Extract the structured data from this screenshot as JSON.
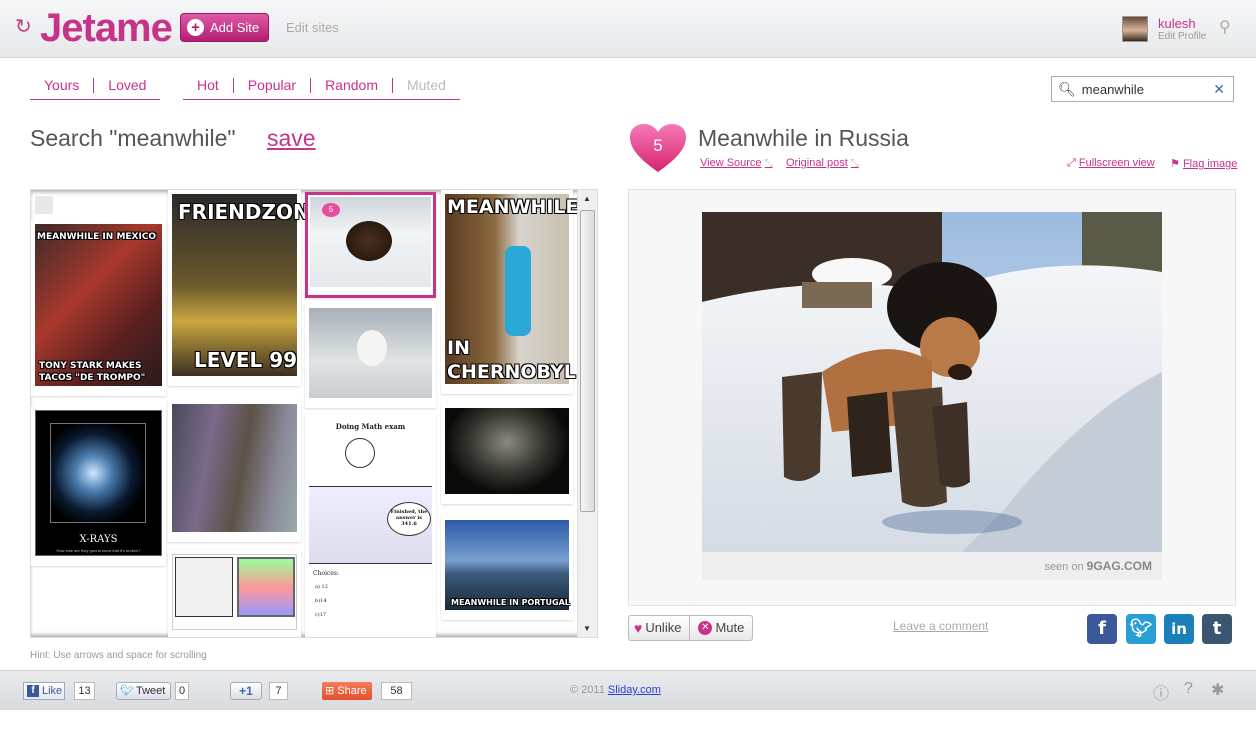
{
  "header": {
    "logo": "Jetame",
    "add_site": "Add Site",
    "edit_sites": "Edit sites",
    "username": "kulesh",
    "edit_profile": "Edit Profile"
  },
  "nav": {
    "left": [
      "Yours",
      "Loved"
    ],
    "right": [
      "Hot",
      "Popular",
      "Random",
      "Muted"
    ]
  },
  "search": {
    "value": "meanwhile",
    "title": "Search \"meanwhile\"",
    "save": "save"
  },
  "grid": {
    "thumbs": [
      {
        "caption_top": "MEANWHILE IN MEXICO",
        "caption_bottom": "TONY STARK MAKES TACOS \"DE TROMPO\""
      },
      {
        "caption_top": "FRIENDZONE",
        "caption_bottom": "LEVEL 99"
      },
      {
        "badge": "5"
      },
      {
        "caption_top": "MEANWHILE",
        "caption_bottom": "IN CHERNOBYL"
      },
      {
        "caption_bottom": "X-RAYS",
        "sub": "How else are they gonna know that it's broken?"
      },
      {
        "title": "Doing Math exam",
        "bubble": "Finished, the answer is 341.6",
        "choices_label": "Choices:",
        "choices": [
          "a) 12",
          "b)14",
          "c)17"
        ]
      },
      {
        "caption_bottom": "MEANWHILE IN PORTUGAL"
      }
    ],
    "hint": "Hint: Use arrows and space for scrolling"
  },
  "post": {
    "likes": "5",
    "title": "Meanwhile in Russia",
    "view_source": "View Source",
    "original_post": "Original post",
    "fullscreen": "Fullscreen view",
    "flag": "Flag image",
    "seen_on_prefix": "seen on",
    "seen_on_site": "9GAG.COM",
    "unlike": "Unlike",
    "mute": "Mute",
    "leave_comment": "Leave a comment",
    "social": [
      "f",
      "t",
      "in",
      "t"
    ]
  },
  "footer": {
    "fb_like": "Like",
    "fb_count": "13",
    "tweet": "Tweet",
    "tweet_count": "0",
    "plus_one": "+1",
    "plus_count": "7",
    "share": "Share",
    "share_count": "58",
    "copyright_prefix": "© 2011",
    "copyright_link": "Sliday.com"
  },
  "colors": {
    "accent": "#c8338a",
    "facebook": "#3b5998",
    "twitter": "#2a9fd6",
    "linkedin": "#1b80b7",
    "tumblr": "#3a5671"
  }
}
